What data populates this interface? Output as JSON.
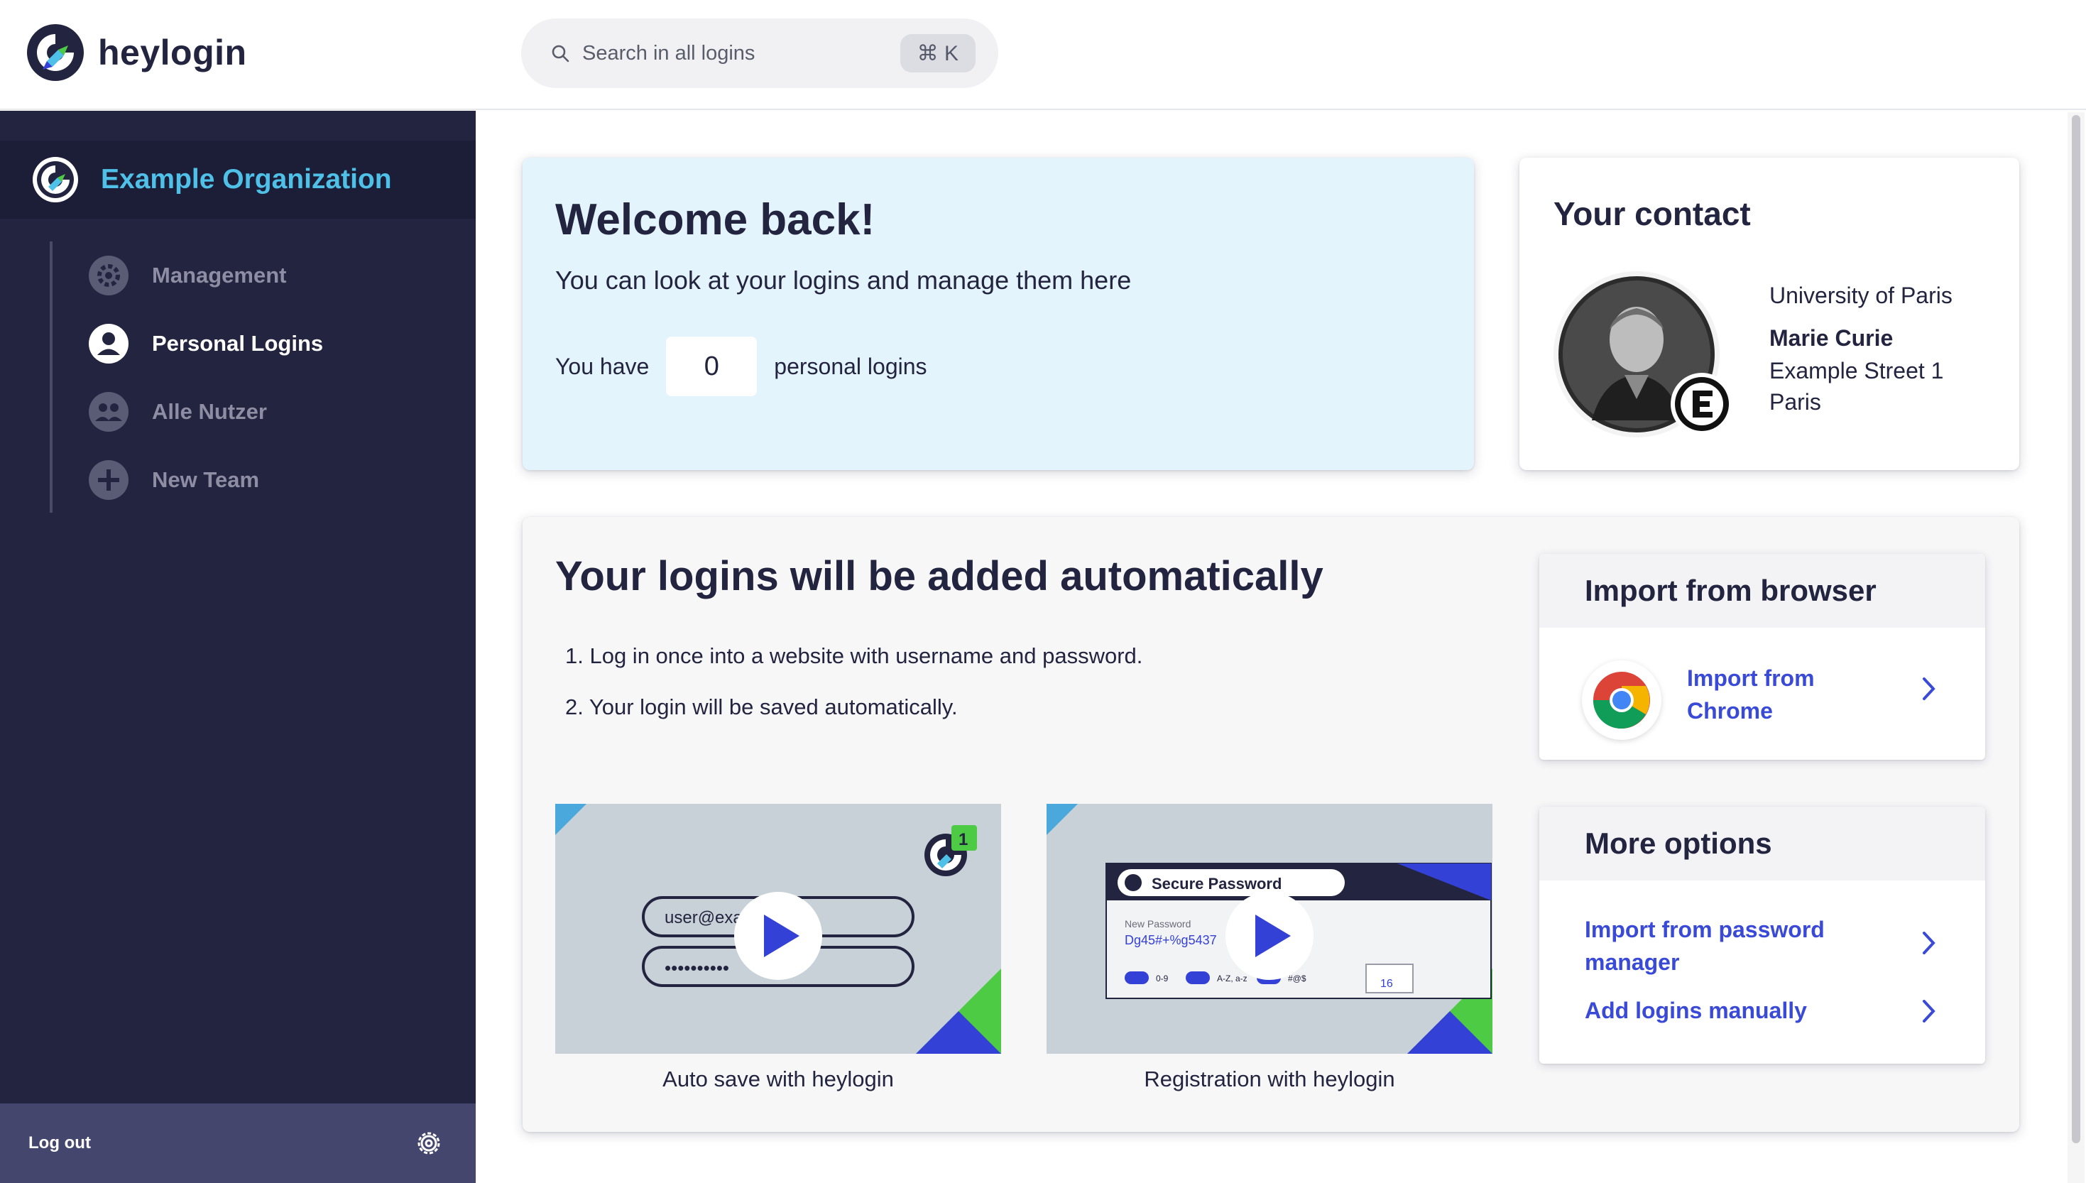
{
  "app": {
    "brand": "heylogin"
  },
  "search": {
    "placeholder": "Search in all logins",
    "shortcut": "⌘ K"
  },
  "sidebar": {
    "organization": "Example Organization",
    "items": [
      {
        "label": "Management",
        "icon": "gear-circle-icon",
        "active": false
      },
      {
        "label": "Personal Logins",
        "icon": "person-circle-icon",
        "active": true
      },
      {
        "label": "Alle Nutzer",
        "icon": "users-circle-icon",
        "active": false
      },
      {
        "label": "New Team",
        "icon": "plus-circle-icon",
        "active": false
      }
    ],
    "logout": "Log out"
  },
  "welcome": {
    "title": "Welcome back!",
    "subtitle": "You can look at your logins and manage them here",
    "prefix": "You have",
    "count": "0",
    "suffix": "personal logins"
  },
  "contact": {
    "title": "Your contact",
    "organization": "University of Paris",
    "name": "Marie Curie",
    "street": "Example Street 1",
    "city": "Paris"
  },
  "auto": {
    "title": "Your logins will be added automatically",
    "steps": [
      "1. Log in once into a website with username and password.",
      "2. Your login will be saved automatically."
    ],
    "videos": [
      {
        "caption": "Auto save with heylogin",
        "field_text": "user@exa",
        "badge": "1"
      },
      {
        "caption": "Registration with heylogin",
        "popup_title": "Secure Password",
        "field_label": "New Password",
        "field_value": "Dg45#+%g5437",
        "toggles": [
          "0-9",
          "A-Z, a-z",
          "#@$"
        ],
        "length": "16"
      }
    ]
  },
  "import_browser": {
    "title": "Import from browser",
    "chrome_label": "Import from Chrome"
  },
  "more_options": {
    "title": "More options",
    "import_pm": "Import from password manager",
    "manual": "Add logins manually"
  },
  "colors": {
    "sidebar": "#23243f",
    "accent": "#4fc0e8",
    "link": "#3a4ad8",
    "welcome_bg": "#e4f4fc"
  }
}
